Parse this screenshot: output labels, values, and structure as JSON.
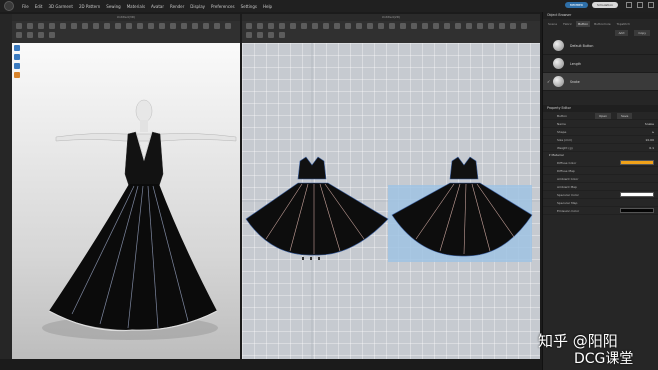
{
  "menubar": {
    "items": [
      "File",
      "Edit",
      "3D Garment",
      "2D Pattern",
      "Sewing",
      "Materials",
      "Avatar",
      "Render",
      "Display",
      "Preferences",
      "Settings",
      "Help"
    ],
    "account_label": "MEMBER",
    "mode_label": "Simulation"
  },
  "viewport3d": {
    "title": "Untitled(3D)"
  },
  "viewport2d": {
    "title": "Untitled(2D)"
  },
  "object_browser": {
    "title": "Object Browser",
    "tabs": [
      "Scene",
      "Fabric",
      "Button",
      "Buttonhole",
      "Topstitch"
    ],
    "active_tab": "Button",
    "add_label": "Add",
    "copy_label": "Copy",
    "items": [
      {
        "label": "Default Button"
      },
      {
        "label": "Length"
      },
      {
        "label": "Snake"
      }
    ]
  },
  "property_editor": {
    "title": "Property Editor",
    "header_name": "Button",
    "header_open": "Open",
    "header_save": "Save",
    "rows": [
      {
        "name": "Name",
        "value": "Snake"
      },
      {
        "name": "Shape",
        "value": ""
      },
      {
        "name": "Size (mm)",
        "value": "10.00"
      },
      {
        "name": "Weight (g)",
        "value": "0.1"
      }
    ],
    "material_section": "Material",
    "material_rows": [
      {
        "name": "Diffuse Color",
        "color": "#f0a21a"
      },
      {
        "name": "Diffuse Map",
        "color": ""
      },
      {
        "name": "Ambient Color",
        "color": ""
      },
      {
        "name": "Ambient Map",
        "color": ""
      },
      {
        "name": "Specular Color",
        "color": "#ffffff"
      },
      {
        "name": "Specular Map",
        "color": ""
      },
      {
        "name": "Emission Color",
        "color": "#050505"
      }
    ]
  },
  "watermark": {
    "line1": "知乎 @阳阳",
    "line2": "DCG课堂"
  },
  "colors": {
    "accent": "#2f6fa8",
    "dress": "#111111",
    "pattern_highlight": "#9fc3e3"
  }
}
